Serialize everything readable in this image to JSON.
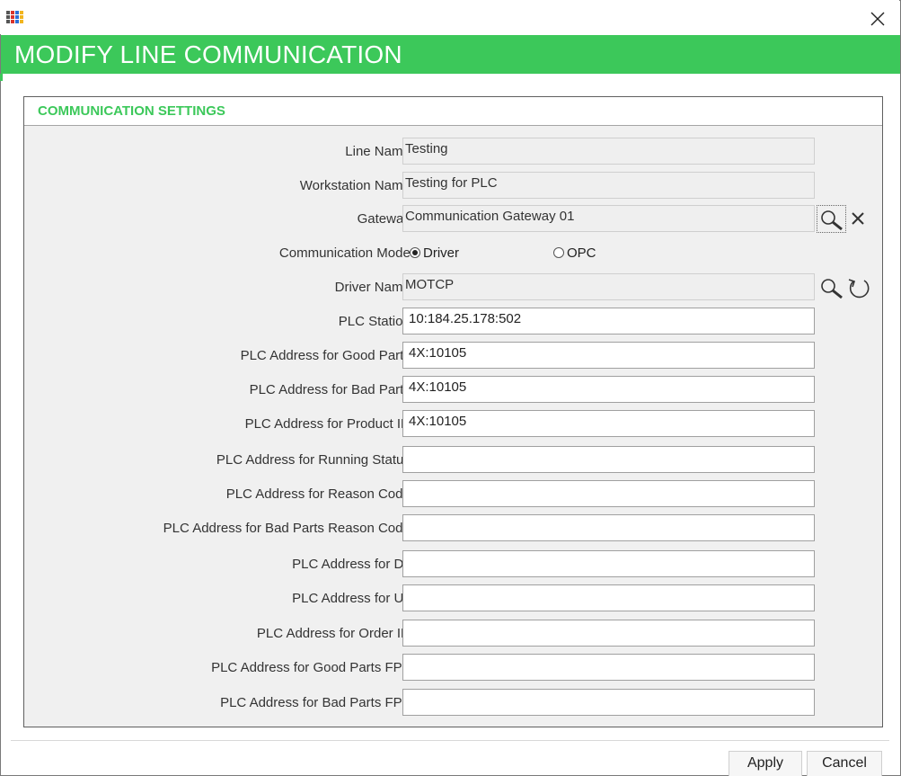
{
  "window": {
    "icon": "app-grid-icon",
    "close_icon": "close-icon"
  },
  "banner": {
    "title": "MODIFY LINE COMMUNICATION",
    "color": "#3cc85a"
  },
  "panel": {
    "title": "COMMUNICATION SETTINGS"
  },
  "fields": {
    "line_name": {
      "label": "Line Name:",
      "value": "Testing"
    },
    "workstation_name": {
      "label": "Workstation Name:",
      "value": "Testing for PLC"
    },
    "gateway": {
      "label": "Gateway:",
      "value": "Communication Gateway 01"
    },
    "comm_mode": {
      "label": "Communication Mode:",
      "options": [
        "Driver",
        "OPC"
      ],
      "selected": "Driver"
    },
    "driver_name": {
      "label": "Driver Name:",
      "value": "MOTCP"
    },
    "plc_station": {
      "label": "PLC Station:",
      "value": "10:184.25.178:502"
    },
    "good_parts": {
      "label": "PLC Address for Good Parts:",
      "value": "4X:10105"
    },
    "bad_parts": {
      "label": "PLC Address for Bad Parts:",
      "value": "4X:10105"
    },
    "product_id": {
      "label": "PLC Address for Product ID:",
      "value": "4X:10105"
    },
    "running_status": {
      "label": "PLC Address for Running Status:",
      "value": ""
    },
    "reason_code": {
      "label": "PLC Address for Reason Code:",
      "value": ""
    },
    "bad_parts_reason_code": {
      "label": "PLC Address for Bad Parts Reason Code:",
      "value": ""
    },
    "dt": {
      "label": "PLC Address for DT:",
      "value": ""
    },
    "ut": {
      "label": "PLC Address for UT:",
      "value": ""
    },
    "order_id": {
      "label": "PLC Address for Order ID:",
      "value": ""
    },
    "good_parts_fpy": {
      "label": "PLC Address for Good Parts FPY:",
      "value": ""
    },
    "bad_parts_fpy": {
      "label": "PLC Address for Bad Parts FPY:",
      "value": ""
    }
  },
  "icons": {
    "gateway_search": "search-icon",
    "gateway_clear": "clear-icon",
    "driver_search": "search-icon",
    "driver_refresh": "refresh-icon"
  },
  "buttons": {
    "apply": "Apply",
    "cancel": "Cancel"
  }
}
